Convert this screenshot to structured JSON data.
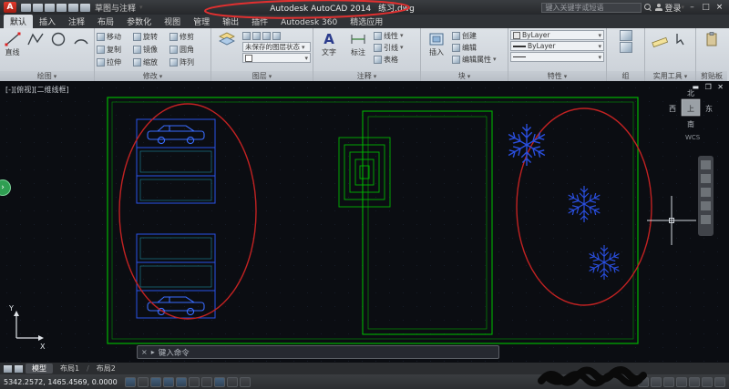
{
  "title_bar": {
    "workspace": "草图与注释",
    "app_title": "Autodesk AutoCAD 2014",
    "filename": "练习.dwg",
    "search_placeholder": "键入关键字或短语",
    "signin_label": "登录"
  },
  "ribbon": {
    "tabs": [
      "默认",
      "插入",
      "注释",
      "布局",
      "参数化",
      "视图",
      "管理",
      "输出",
      "插件",
      "Autodesk 360",
      "精选应用"
    ],
    "panels": {
      "draw": {
        "title": "绘图",
        "line_label": "直线"
      },
      "modify": {
        "title": "修改",
        "items": [
          "移动",
          "旋转",
          "修剪",
          "复制",
          "镜像",
          "圆角",
          "拉伸",
          "缩放",
          "阵列"
        ]
      },
      "layers": {
        "title": "图层",
        "layer_state": "未保存的图层状态"
      },
      "annotation": {
        "title": "注释",
        "text_label": "文字",
        "dim_label": "标注",
        "linear_label": "线性",
        "leader_label": "引线",
        "table_label": "表格"
      },
      "block": {
        "title": "块",
        "insert_label": "插入",
        "create_label": "创建",
        "edit_label": "编辑",
        "edit_attr_label": "编辑属性"
      },
      "properties": {
        "title": "特性",
        "rows": [
          "ByLayer",
          "ByLayer"
        ]
      },
      "groups": {
        "title": "组"
      },
      "utilities": {
        "title": "实用工具"
      },
      "clipboard": {
        "title": "剪贴板"
      }
    }
  },
  "canvas": {
    "viewport_label": "[-][俯视][二维线框]",
    "viewcube": {
      "north": "北",
      "south": "南",
      "east": "东",
      "west": "西",
      "top": "上",
      "wcs": "WCS"
    }
  },
  "command_line": {
    "prompt": "键入命令"
  },
  "layout_tabs": {
    "model": "模型",
    "layout1": "布局1",
    "layout2": "布局2"
  },
  "status_bar": {
    "coordinates": "5342.2572, 1465.4569, 0.0000"
  },
  "icons": {
    "app_logo": "A",
    "dropdown": "▾",
    "close": "×",
    "minimize": "–",
    "maximize": "□",
    "text_icon": "A",
    "start_arrow": "›",
    "cmd_close": "×",
    "cmd_caret": "▸"
  },
  "colors": {
    "boundary_green": "#00b400",
    "entity_blue": "#2a52e8",
    "highlight_red": "#d02020",
    "canvas_bg": "#0b0d12",
    "annotation_red": "#e03030"
  }
}
